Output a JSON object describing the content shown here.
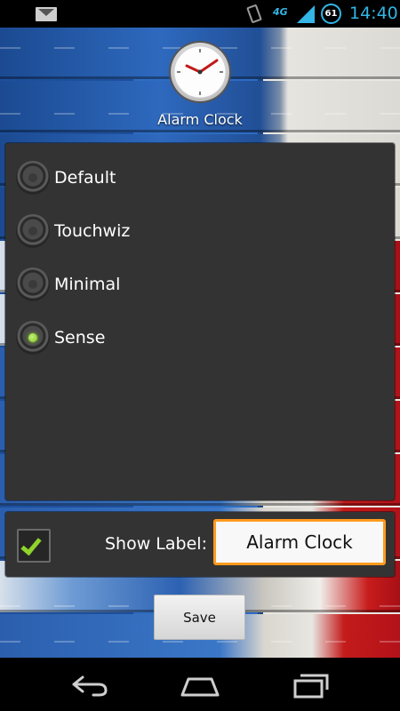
{
  "status_bar": {
    "icons": [
      "gmail-icon",
      "vibrate-icon",
      "network-4g-icon",
      "signal-icon",
      "battery-icon"
    ],
    "network_type": "4G",
    "battery_level": "61",
    "time": "14:40"
  },
  "header": {
    "icon": "alarm-clock-icon",
    "title": "Alarm Clock"
  },
  "styles": {
    "options": [
      {
        "label": "Default",
        "selected": false
      },
      {
        "label": "Touchwiz",
        "selected": false
      },
      {
        "label": "Minimal",
        "selected": false
      },
      {
        "label": "Sense",
        "selected": true
      }
    ]
  },
  "label_settings": {
    "show_label_checked": true,
    "show_label_text": "Show Label:",
    "label_value": "Alarm Clock"
  },
  "actions": {
    "save_label": "Save"
  },
  "navigation": {
    "icons": [
      "back-icon",
      "home-icon",
      "recent-apps-icon"
    ]
  },
  "colors": {
    "accent": "#33b5e5",
    "selected_radio": "#8fd42a",
    "input_focus_border": "#ff9a1f",
    "panel_background": "#333333"
  }
}
